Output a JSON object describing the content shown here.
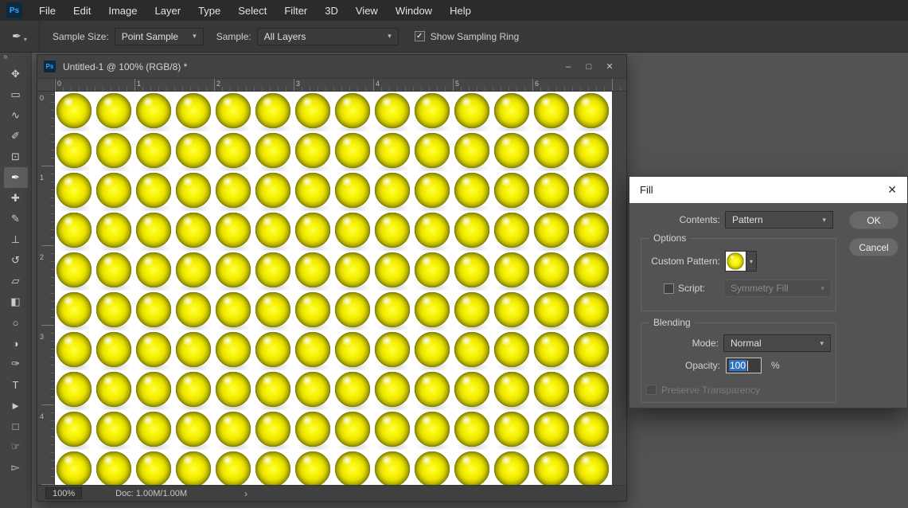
{
  "app": {
    "chevron_down": "▾",
    "check": "✓",
    "accent_blue": "#3173c2",
    "background": "#535353"
  },
  "menubar": {
    "logo_text": "Ps",
    "items": [
      "File",
      "Edit",
      "Image",
      "Layer",
      "Type",
      "Select",
      "Filter",
      "3D",
      "View",
      "Window",
      "Help"
    ]
  },
  "options_bar": {
    "tool_glyph": "✒",
    "sample_size_label": "Sample Size:",
    "sample_size_value": "Point Sample",
    "sample_label": "Sample:",
    "sample_value": "All Layers",
    "sampling_ring_label": "Show Sampling Ring",
    "sampling_ring_checked": true
  },
  "toolbar": {
    "collapse_glyph": "»",
    "tools": [
      {
        "name": "move-tool",
        "glyph": "✥",
        "selected": false
      },
      {
        "name": "rectangular-marquee-tool",
        "glyph": "▭",
        "selected": false
      },
      {
        "name": "lasso-tool",
        "glyph": "∿",
        "selected": false
      },
      {
        "name": "quick-selection-tool",
        "glyph": "✐",
        "selected": false
      },
      {
        "name": "crop-tool",
        "glyph": "⊡",
        "selected": false
      },
      {
        "name": "eyedropper-tool",
        "glyph": "✒",
        "selected": true
      },
      {
        "name": "spot-healing-brush-tool",
        "glyph": "✚",
        "selected": false
      },
      {
        "name": "brush-tool",
        "glyph": "✎",
        "selected": false
      },
      {
        "name": "clone-stamp-tool",
        "glyph": "⊥",
        "selected": false
      },
      {
        "name": "history-brush-tool",
        "glyph": "↺",
        "selected": false
      },
      {
        "name": "eraser-tool",
        "glyph": "▱",
        "selected": false
      },
      {
        "name": "gradient-tool",
        "glyph": "◧",
        "selected": false
      },
      {
        "name": "blur-tool",
        "glyph": "○",
        "selected": false
      },
      {
        "name": "dodge-tool",
        "glyph": "◑",
        "selected": false
      },
      {
        "name": "pen-tool",
        "glyph": "✑",
        "selected": false
      },
      {
        "name": "type-tool",
        "glyph": "T",
        "selected": false
      },
      {
        "name": "path-selection-tool",
        "glyph": "►",
        "selected": false
      },
      {
        "name": "rectangle-tool",
        "glyph": "□",
        "selected": false
      },
      {
        "name": "hand-tool",
        "glyph": "☞",
        "selected": false
      },
      {
        "name": "direct-selection-tool",
        "glyph": "▻",
        "selected": false
      }
    ]
  },
  "document_window": {
    "title": "Untitled-1 @ 100% (RGB/8) *",
    "icon_text": "Ps",
    "controls": {
      "minimize": "–",
      "maximize": "□",
      "close": "✕"
    },
    "ruler_top": [
      "0",
      "1",
      "2",
      "3",
      "4",
      "5",
      "6"
    ],
    "ruler_left": [
      "0",
      "1",
      "2",
      "3",
      "4"
    ],
    "status": {
      "zoom": "100%",
      "doc": "Doc: 1.00M/1.00M",
      "chevron": "›"
    }
  },
  "canvas": {
    "pattern": "yellow-sphere-grid",
    "ball_color": "#f6ef00",
    "background": "#ffffff",
    "selection_active": true
  },
  "fill_dialog": {
    "title": "Fill",
    "close_glyph": "✕",
    "contents_label": "Contents:",
    "contents_value": "Pattern",
    "ok_label": "OK",
    "cancel_label": "Cancel",
    "options_group": {
      "label": "Options",
      "custom_pattern_label": "Custom Pattern:",
      "script_label": "Script:",
      "script_checked": false,
      "script_value": "Symmetry Fill",
      "script_enabled": false
    },
    "blending_group": {
      "label": "Blending",
      "mode_label": "Mode:",
      "mode_value": "Normal",
      "opacity_label": "Opacity:",
      "opacity_value": "100",
      "opacity_unit": "%",
      "preserve_label": "Preserve Transparency",
      "preserve_checked": false,
      "preserve_enabled": false
    }
  }
}
